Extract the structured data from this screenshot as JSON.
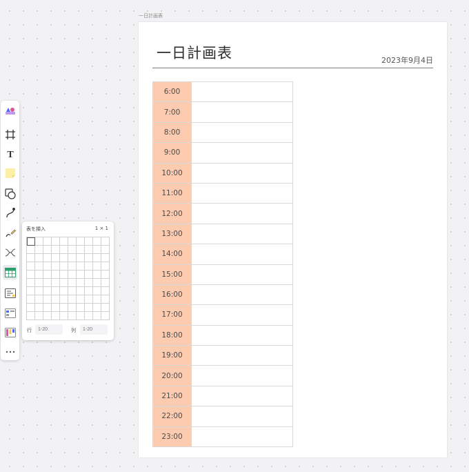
{
  "frame": {
    "label": "一日計画表"
  },
  "page": {
    "title": "一日計画表",
    "date": "2023年9月4日",
    "schedule": [
      {
        "time": "6:00"
      },
      {
        "time": "7:00"
      },
      {
        "time": "8:00"
      },
      {
        "time": "9:00"
      },
      {
        "time": "10:00"
      },
      {
        "time": "11:00"
      },
      {
        "time": "12:00"
      },
      {
        "time": "13:00"
      },
      {
        "time": "14:00"
      },
      {
        "time": "15:00"
      },
      {
        "time": "16:00"
      },
      {
        "time": "17:00"
      },
      {
        "time": "18:00"
      },
      {
        "time": "19:00"
      },
      {
        "time": "20:00"
      },
      {
        "time": "21:00"
      },
      {
        "time": "22:00"
      },
      {
        "time": "23:00"
      }
    ]
  },
  "toolbar": {
    "tools": [
      {
        "icon": "templates-icon"
      },
      {
        "icon": "frame-icon"
      },
      {
        "icon": "text-icon"
      },
      {
        "icon": "sticky-note-icon"
      },
      {
        "icon": "shapes-icon"
      },
      {
        "icon": "connector-line-icon"
      },
      {
        "icon": "pen-icon"
      },
      {
        "icon": "mindmap-icon"
      },
      {
        "icon": "table-icon",
        "active": true
      },
      {
        "icon": "card-icon"
      },
      {
        "icon": "kanban-icon"
      },
      {
        "icon": "flowchart-icon"
      },
      {
        "icon": "more-icon"
      }
    ]
  },
  "insert_table": {
    "title": "表を挿入",
    "size": "1 × 1",
    "rows_label": "行",
    "rows_placeholder": "1-20",
    "cols_label": "列",
    "cols_placeholder": "1-20",
    "grid_rows": 10,
    "grid_cols": 10
  },
  "colors": {
    "time_cell": "#fdcbb0",
    "table_icon": "#2e9e6a",
    "sticky_note": "#fdf0a6"
  }
}
